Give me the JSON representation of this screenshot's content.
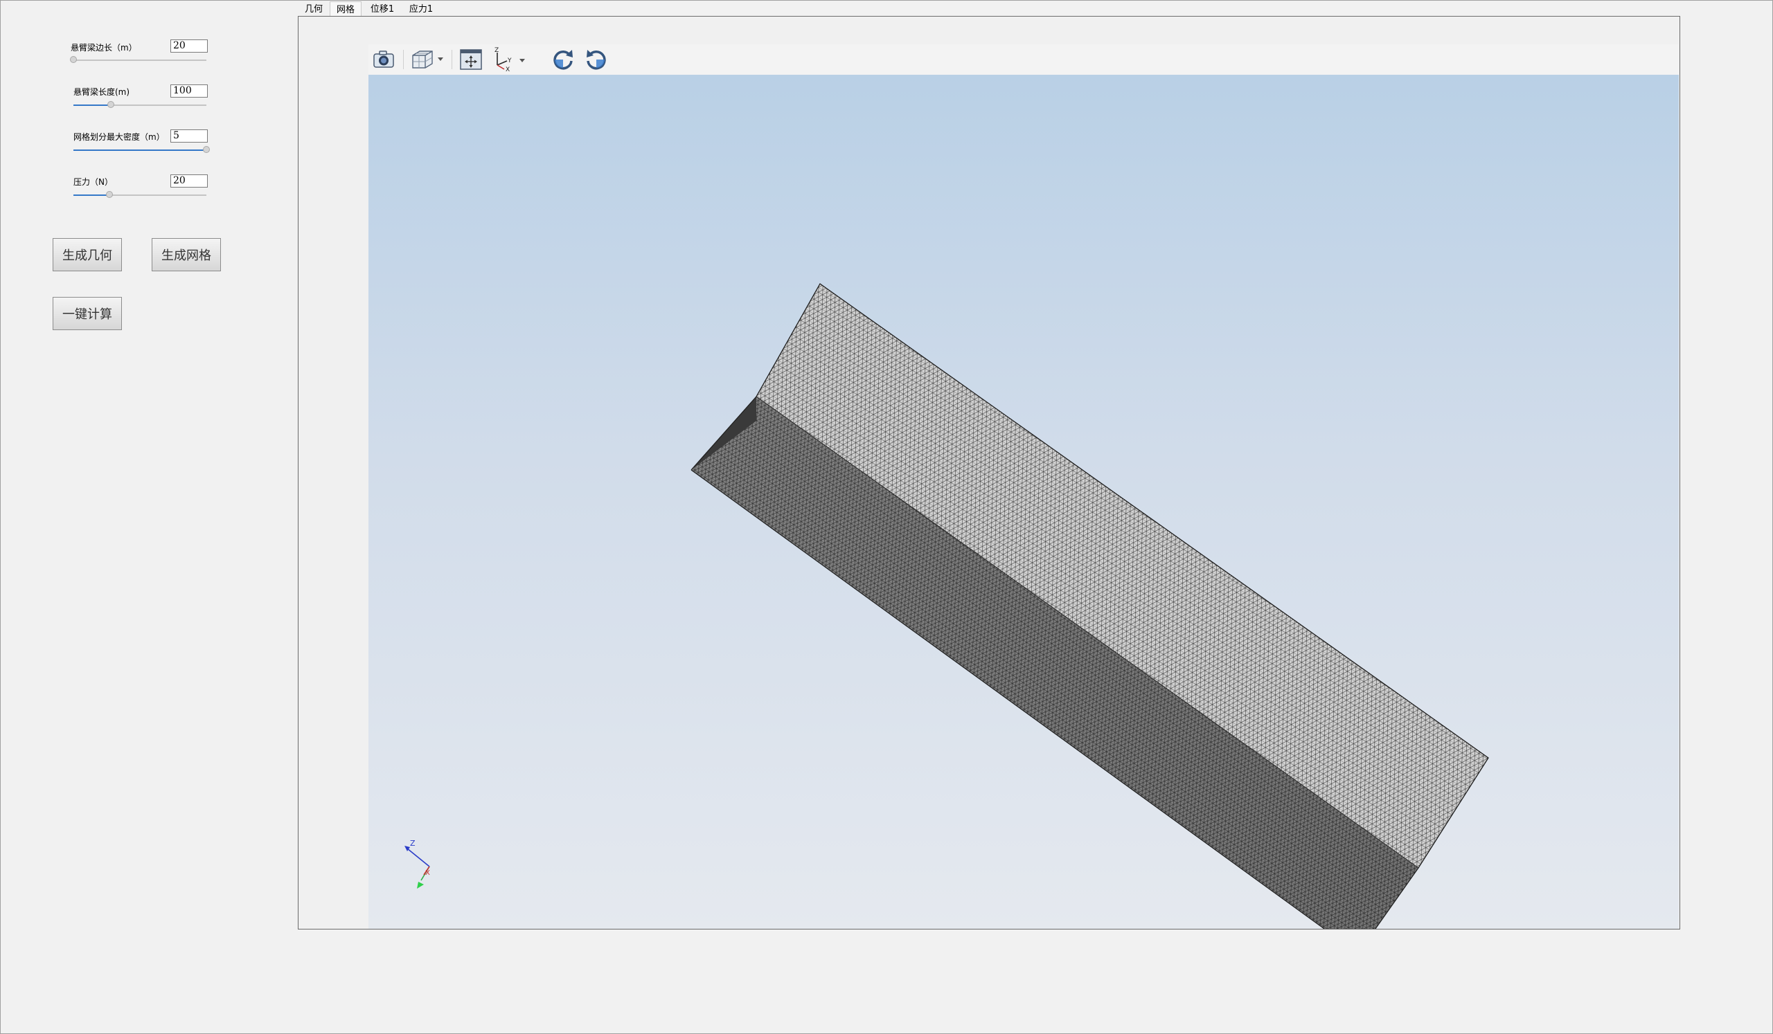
{
  "params": [
    {
      "label": "悬臂梁边长（m）",
      "value": "20",
      "slider_fraction": 0.0
    },
    {
      "label": "悬臂梁长度(m)",
      "value": "100",
      "slider_fraction": 0.28
    },
    {
      "label": "网格划分最大密度（m）",
      "value": "5",
      "slider_fraction": 1.0
    },
    {
      "label": "压力（N）",
      "value": "20",
      "slider_fraction": 0.27
    }
  ],
  "buttons": {
    "generate_geometry": "生成几何",
    "generate_mesh": "生成网格",
    "one_click_compute": "一键计算"
  },
  "tabs": [
    {
      "label": "几何",
      "active": false
    },
    {
      "label": "网格",
      "active": true
    },
    {
      "label": "位移1",
      "active": false
    },
    {
      "label": "应力1",
      "active": false
    }
  ],
  "toolbar": {
    "icons": [
      "camera-icon",
      "view-cube-icon",
      "fit-view-icon",
      "axes-icon",
      "rotate-cw-icon",
      "rotate-ccw-icon"
    ]
  },
  "viewport": {
    "triad_labels": {
      "z": "Z",
      "x": "X"
    },
    "axis_labels": {
      "z": "Z",
      "y": "Y",
      "x": "X"
    }
  },
  "colors": {
    "accent": "#3478c8",
    "mesh_fill": "#c9c9c9",
    "mesh_dark": "#7b7b7b",
    "bg_top": "#b9d0e6",
    "bg_bottom": "#e5e9ef"
  }
}
